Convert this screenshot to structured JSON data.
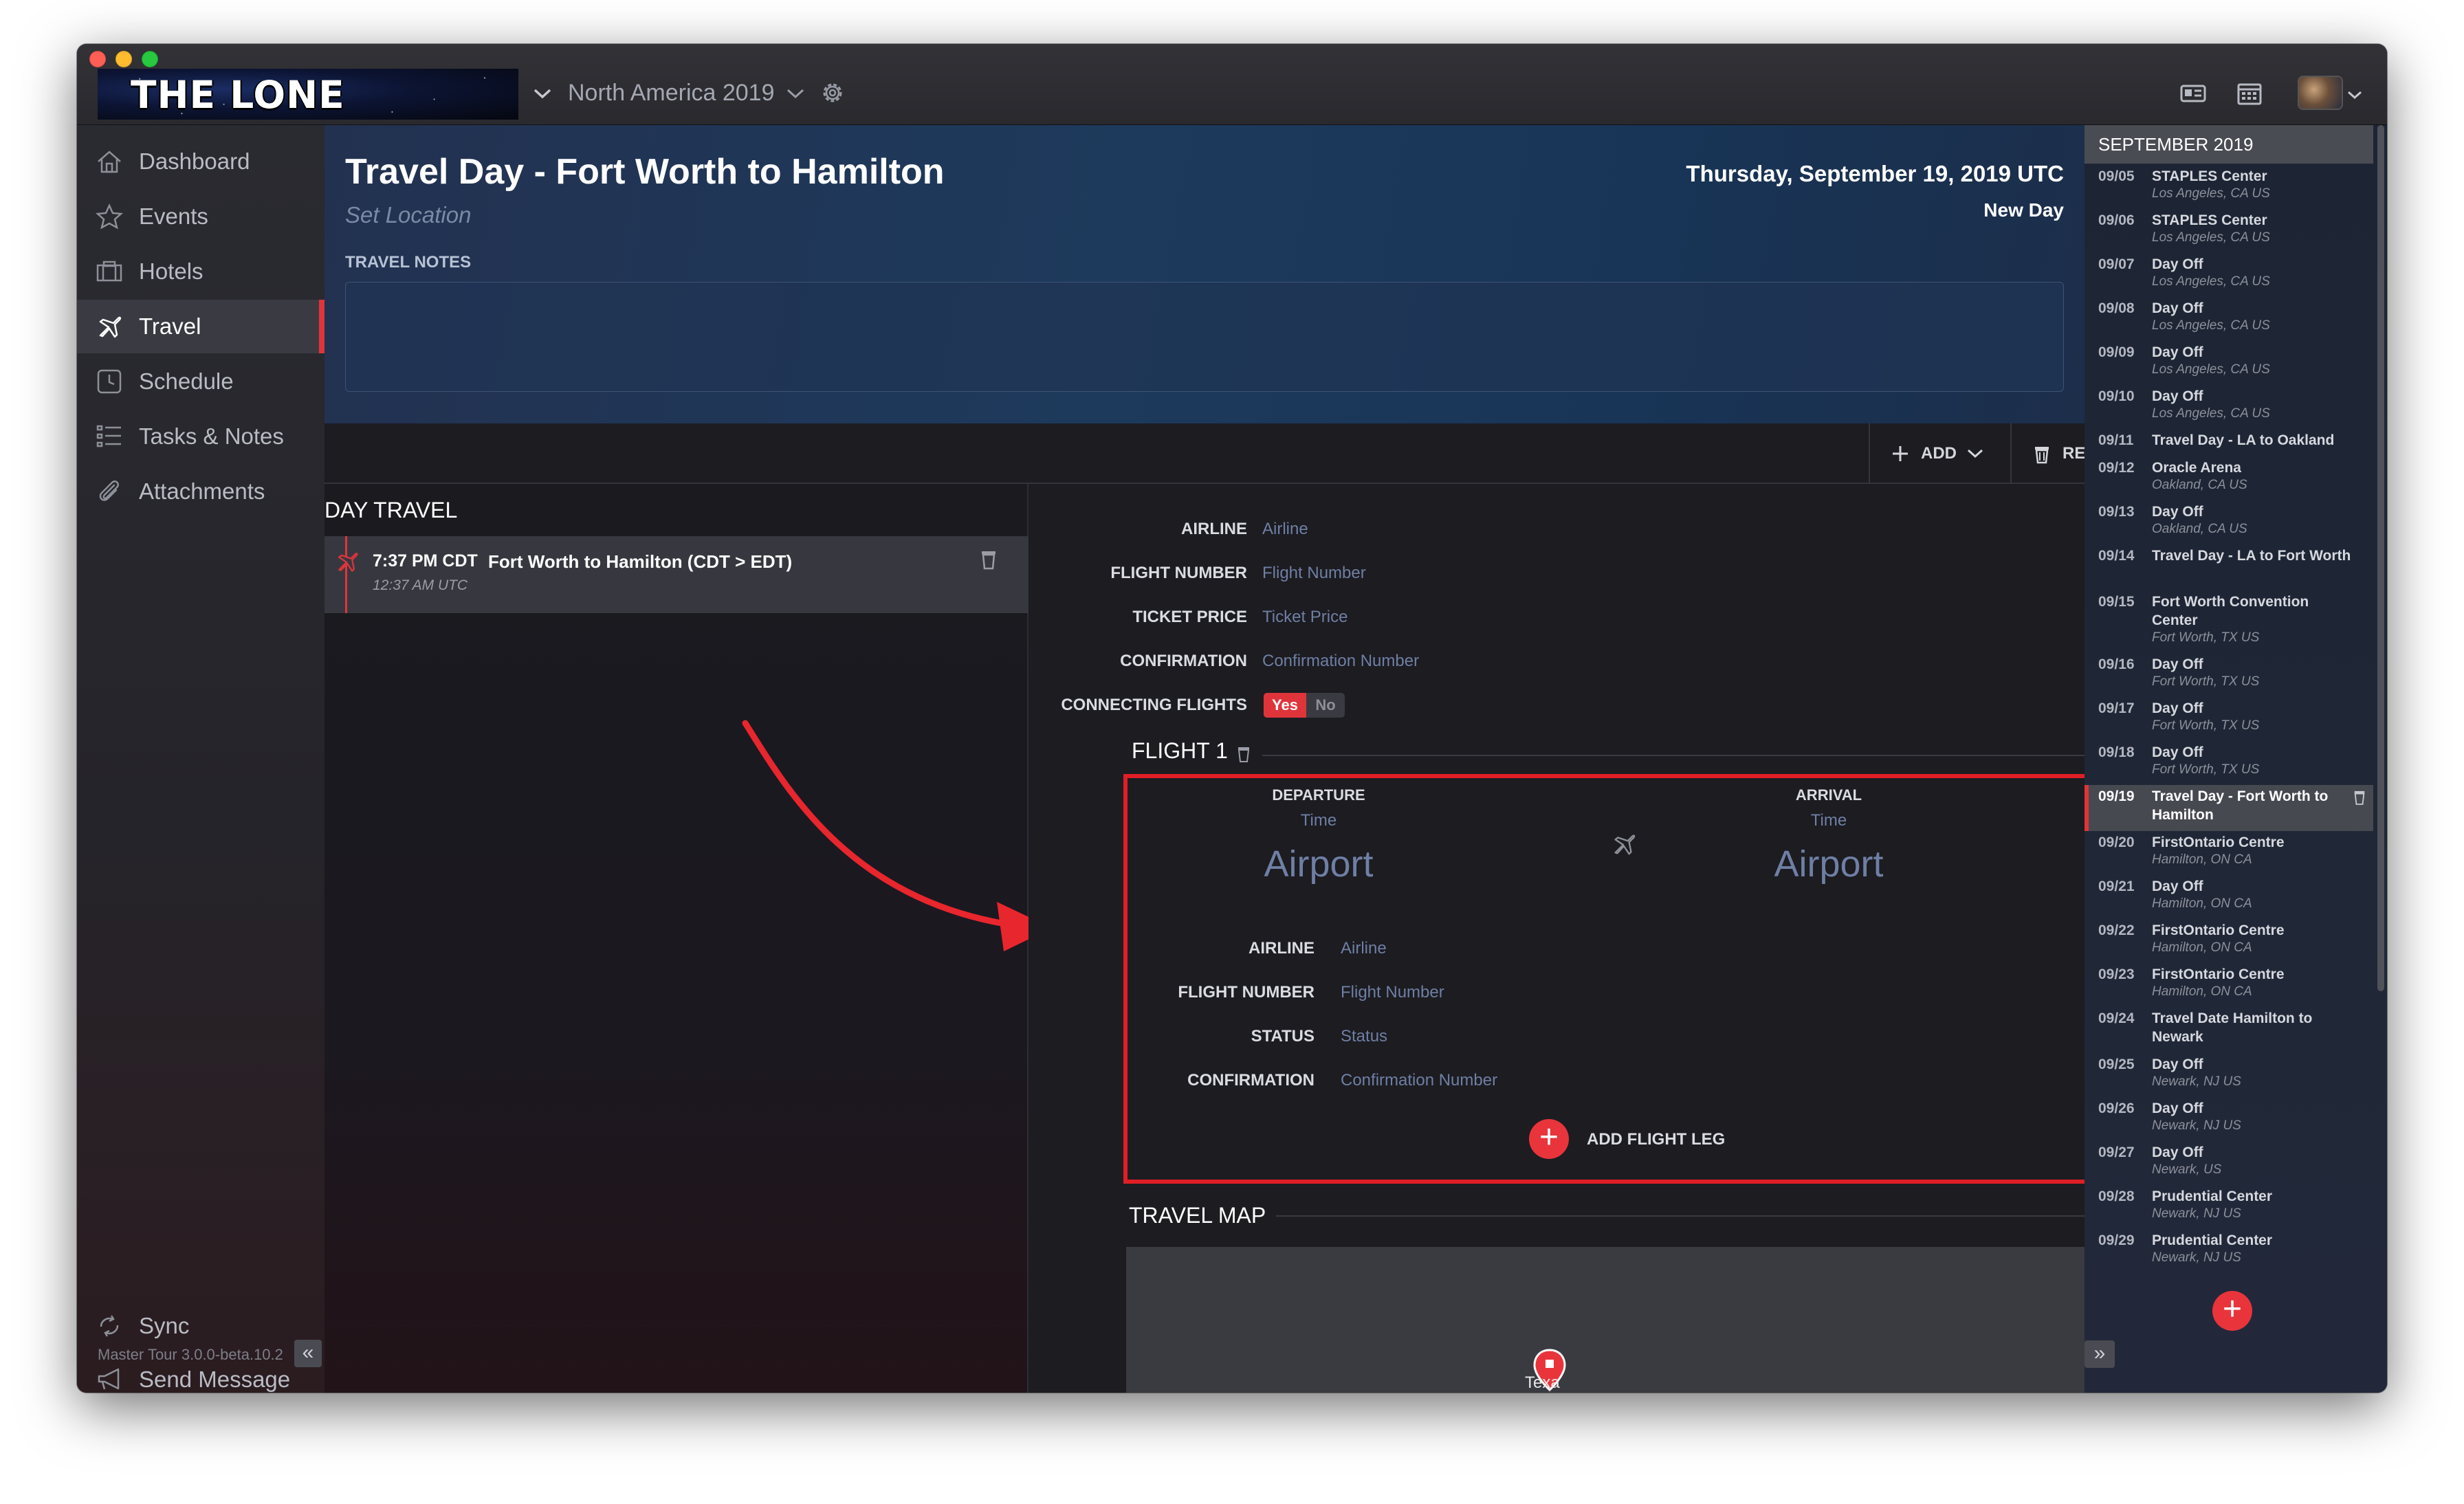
{
  "titlebar": {
    "brand": "THE LONE RANGERS",
    "tour": "North America 2019"
  },
  "sidebar": {
    "items": [
      {
        "label": "Dashboard",
        "icon": "home-icon"
      },
      {
        "label": "Events",
        "icon": "star-icon"
      },
      {
        "label": "Hotels",
        "icon": "hotel-icon"
      },
      {
        "label": "Travel",
        "icon": "plane-icon",
        "active": true
      },
      {
        "label": "Schedule",
        "icon": "clock-icon"
      },
      {
        "label": "Tasks & Notes",
        "icon": "list-icon"
      },
      {
        "label": "Attachments",
        "icon": "paperclip-icon"
      }
    ],
    "sync": "Sync",
    "send_message": "Send Message",
    "version": "Master Tour 3.0.0-beta.10.2",
    "collapse": "«"
  },
  "header": {
    "title": "Travel Day - Fort Worth to Hamilton",
    "set_location": "Set Location",
    "notes_label": "TRAVEL NOTES",
    "notes_value": "",
    "date": "Thursday, September 19, 2019 UTC",
    "new_day": "New Day"
  },
  "toolbar": {
    "add_label": "ADD",
    "remove_label": "REMOVE"
  },
  "day_travel": {
    "title": "DAY TRAVEL",
    "item": {
      "time": "7:37 PM CDT",
      "title": "Fort Worth to Hamilton (CDT > EDT)",
      "sub": "12:37 AM UTC"
    }
  },
  "details": {
    "airline_label": "AIRLINE",
    "airline_placeholder": "Airline",
    "flight_number_label": "FLIGHT NUMBER",
    "flight_number_placeholder": "Flight Number",
    "ticket_price_label": "TICKET PRICE",
    "ticket_price_placeholder": "Ticket Price",
    "confirmation_label": "CONFIRMATION",
    "confirmation_placeholder": "Confirmation Number",
    "connecting_label": "CONNECTING FLIGHTS",
    "yes": "Yes",
    "no": "No",
    "connecting_value": "Yes"
  },
  "flight1": {
    "title": "FLIGHT 1",
    "departure_label": "DEPARTURE",
    "arrival_label": "ARRIVAL",
    "time_placeholder": "Time",
    "airport_placeholder": "Airport",
    "airline_label": "AIRLINE",
    "airline_placeholder": "Airline",
    "flight_number_label": "FLIGHT NUMBER",
    "flight_number_placeholder": "Flight Number",
    "status_label": "STATUS",
    "status_placeholder": "Status",
    "confirmation_label": "CONFIRMATION",
    "confirmation_placeholder": "Confirmation Number",
    "add_leg": "ADD FLIGHT LEG"
  },
  "travel_map": {
    "title": "TRAVEL MAP",
    "pin_label": "Texa"
  },
  "calendar": {
    "month": "SEPTEMBER 2019",
    "entries": [
      {
        "date": "09/05",
        "title": "STAPLES Center",
        "location": "Los Angeles, CA US"
      },
      {
        "date": "09/06",
        "title": "STAPLES Center",
        "location": "Los Angeles, CA US"
      },
      {
        "date": "09/07",
        "title": "Day Off",
        "location": "Los Angeles, CA US"
      },
      {
        "date": "09/08",
        "title": "Day Off",
        "location": "Los Angeles, CA US"
      },
      {
        "date": "09/09",
        "title": "Day Off",
        "location": "Los Angeles, CA US"
      },
      {
        "date": "09/10",
        "title": "Day Off",
        "location": "Los Angeles, CA US"
      },
      {
        "date": "09/11",
        "title": "Travel Day - LA to Oakland",
        "location": ""
      },
      {
        "date": "09/12",
        "title": "Oracle Arena",
        "location": "Oakland, CA US"
      },
      {
        "date": "09/13",
        "title": "Day Off",
        "location": "Oakland, CA US"
      },
      {
        "date": "09/14",
        "title": "Travel Day - LA to Fort Worth",
        "location": ""
      },
      {
        "date": "09/15",
        "title": "Fort Worth Convention Center",
        "location": "Fort Worth, TX US"
      },
      {
        "date": "09/16",
        "title": "Day Off",
        "location": "Fort Worth, TX US"
      },
      {
        "date": "09/17",
        "title": "Day Off",
        "location": "Fort Worth, TX US"
      },
      {
        "date": "09/18",
        "title": "Day Off",
        "location": "Fort Worth, TX US"
      },
      {
        "date": "09/19",
        "title": "Travel Day - Fort Worth to Hamilton",
        "location": "",
        "selected": true
      },
      {
        "date": "09/20",
        "title": "FirstOntario Centre",
        "location": "Hamilton, ON CA"
      },
      {
        "date": "09/21",
        "title": "Day Off",
        "location": "Hamilton, ON CA"
      },
      {
        "date": "09/22",
        "title": "FirstOntario Centre",
        "location": "Hamilton, ON CA"
      },
      {
        "date": "09/23",
        "title": "FirstOntario Centre",
        "location": "Hamilton, ON CA"
      },
      {
        "date": "09/24",
        "title": "Travel Date Hamilton to Newark",
        "location": ""
      },
      {
        "date": "09/25",
        "title": "Day Off",
        "location": "Newark, NJ US"
      },
      {
        "date": "09/26",
        "title": "Day Off",
        "location": "Newark, NJ US"
      },
      {
        "date": "09/27",
        "title": "Day Off",
        "location": "Newark, US"
      },
      {
        "date": "09/28",
        "title": "Prudential Center",
        "location": "Newark, NJ US"
      },
      {
        "date": "09/29",
        "title": "Prudential Center",
        "location": "Newark, NJ US"
      }
    ],
    "add": "+",
    "expand": "»"
  },
  "colors": {
    "accent_red": "#e0343b",
    "highlight_box": "#e01e26",
    "placeholder_blue": "#6f7fa4"
  }
}
